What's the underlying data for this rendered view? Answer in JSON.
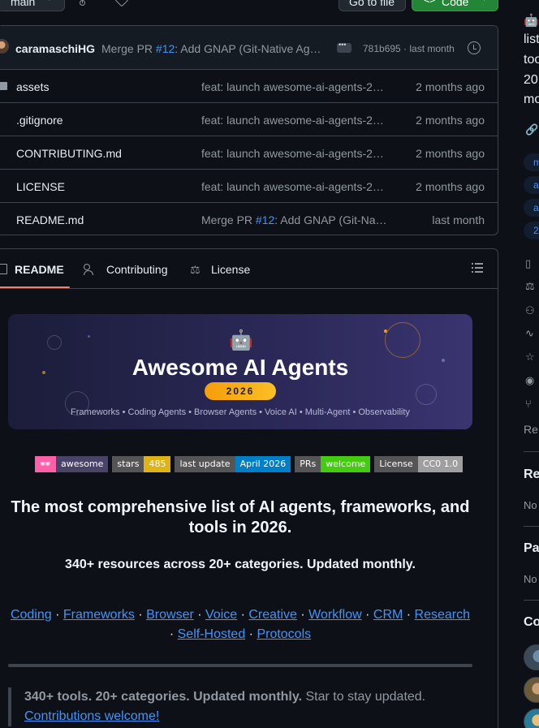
{
  "topbar": {
    "branch": "main",
    "go_to_file": "Go to file",
    "code": "Code",
    "code_icon": "<>"
  },
  "commit": {
    "author": "caramaschiHG",
    "message_prefix": "Merge PR ",
    "pr": "#12",
    "message_suffix": ": Add GNAP (Git-Native Ag…",
    "hash_time": "781b695 · last month"
  },
  "files": [
    {
      "name": "assets",
      "type": "folder",
      "msg": "feat: launch awesome-ai-agents-2…",
      "date": "2 months ago"
    },
    {
      "name": ".gitignore",
      "type": "file",
      "msg": "feat: launch awesome-ai-agents-2…",
      "date": "2 months ago"
    },
    {
      "name": "CONTRIBUTING.md",
      "type": "file",
      "msg": "feat: launch awesome-ai-agents-2…",
      "date": "2 months ago"
    },
    {
      "name": "LICENSE",
      "type": "file",
      "msg": "feat: launch awesome-ai-agents-2…",
      "date": "2 months ago"
    },
    {
      "name": "README.md",
      "type": "file",
      "msg_prefix": "Merge PR ",
      "pr": "#12",
      "msg_suffix": ": Add GNAP (Git-Na…",
      "date": "last month"
    }
  ],
  "readme_tabs": {
    "readme": "README",
    "contributing": "Contributing",
    "license": "License"
  },
  "banner": {
    "robot": "🤖",
    "title": "Awesome AI Agents",
    "year": "2026",
    "subtitle": "Frameworks • Coding Agents • Browser Agents • Voice AI • Multi-Agent • Observability"
  },
  "badges": [
    {
      "left": "🕶",
      "right": "awesome",
      "lcolor": "#fc60a8",
      "rcolor": "#494368"
    },
    {
      "left": "stars",
      "right": "485",
      "lcolor": "#555555",
      "rcolor": "#dfb317"
    },
    {
      "left": "last update",
      "right": "April 2026",
      "lcolor": "#555555",
      "rcolor": "#007ec6"
    },
    {
      "left": "PRs",
      "right": "welcome",
      "lcolor": "#555555",
      "rcolor": "#4c1"
    },
    {
      "left": "License",
      "right": "CC0 1.0",
      "lcolor": "#555555",
      "rcolor": "#9f9f9f"
    }
  ],
  "readme": {
    "heading": "The most comprehensive list of AI agents, frameworks, and tools in 2026.",
    "subheading": "340+ resources across 20+ categories. Updated monthly.",
    "links_line1": [
      "Coding",
      "Frameworks",
      "Browser",
      "Voice",
      "Creative",
      "Workflow",
      "CRM",
      "Research"
    ],
    "links_line2": [
      "Self-Hosted",
      "Protocols"
    ],
    "separator": " · ",
    "quote_bold": "340+ tools. 20+ categories. Updated monthly.",
    "quote_text": " Star to stay updated.",
    "quote_link": "Contributions welcome!"
  },
  "sidebar": {
    "about_lines": [
      "🤖",
      "list",
      "too",
      "20",
      "mo"
    ],
    "topics": [
      "m",
      "a",
      "a",
      "2"
    ],
    "readme_short": "Re",
    "releases": "Re",
    "no_releases": "No",
    "packages": "Pa",
    "no_packages": "No",
    "contributors": "Co"
  },
  "colors": {
    "accent_link": "#4493f8",
    "code_green": "#238636",
    "tab_underline": "#f78166"
  }
}
